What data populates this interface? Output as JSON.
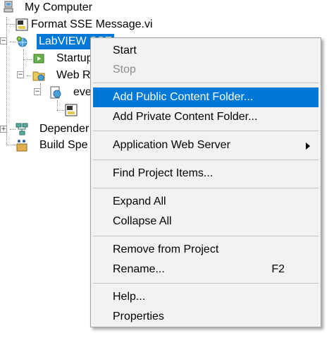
{
  "tree": {
    "root_label": "My Computer",
    "items": [
      {
        "label": "Format SSE Message.vi"
      },
      {
        "label": "LabVIEW SSE"
      },
      {
        "label": "Startup"
      },
      {
        "label": "Web R"
      },
      {
        "label": "eve"
      },
      {
        "label": "Depender"
      },
      {
        "label": "Build Spe"
      }
    ]
  },
  "context_menu": {
    "items": {
      "start": "Start",
      "stop": "Stop",
      "add_public": "Add Public Content Folder...",
      "add_private": "Add Private Content Folder...",
      "app_web_server": "Application Web Server",
      "find_items": "Find Project Items...",
      "expand_all": "Expand All",
      "collapse_all": "Collapse All",
      "remove": "Remove from Project",
      "rename": "Rename...",
      "rename_shortcut": "F2",
      "help": "Help...",
      "properties": "Properties"
    },
    "highlighted": "Add Public Content Folder...",
    "disabled": [
      "Stop"
    ],
    "colors": {
      "highlight": "#0078d7",
      "background": "#f2f2f2",
      "disabled_text": "#8d8d8d"
    }
  }
}
